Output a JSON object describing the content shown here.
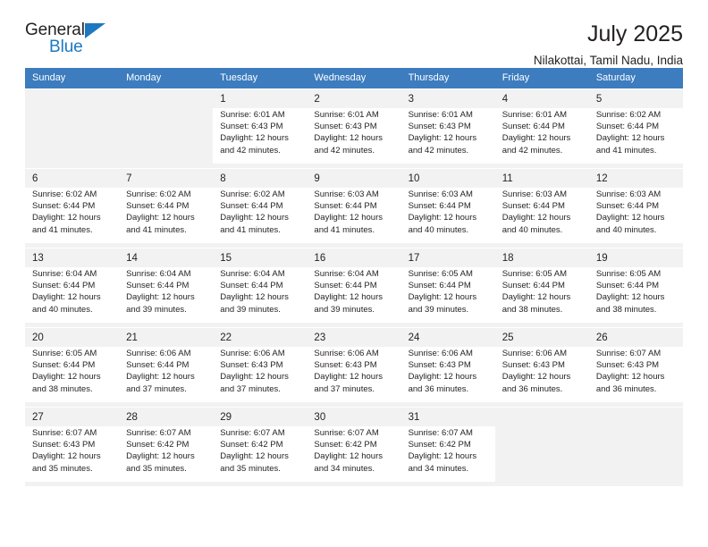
{
  "brand": {
    "word_one": "General",
    "word_two": "Blue",
    "triangle_icon": "brand-triangle-icon"
  },
  "header": {
    "title": "July 2025",
    "location": "Nilakottai, Tamil Nadu, India"
  },
  "colors": {
    "header_row_bg": "#3c7cbf",
    "brand_blue": "#1c79c0",
    "shaded_row_bg": "#f2f2f2",
    "text": "#231f20"
  },
  "weekday_headers": [
    "Sunday",
    "Monday",
    "Tuesday",
    "Wednesday",
    "Thursday",
    "Friday",
    "Saturday"
  ],
  "labels": {
    "sunrise_prefix": "Sunrise:",
    "sunset_prefix": "Sunset:",
    "daylight_prefix": "Daylight:"
  },
  "weeks": [
    [
      {
        "day": "",
        "sunrise": "",
        "sunset": "",
        "daylight_line1": "",
        "daylight_line2": ""
      },
      {
        "day": "",
        "sunrise": "",
        "sunset": "",
        "daylight_line1": "",
        "daylight_line2": ""
      },
      {
        "day": "1",
        "sunrise": "Sunrise: 6:01 AM",
        "sunset": "Sunset: 6:43 PM",
        "daylight_line1": "Daylight: 12 hours",
        "daylight_line2": "and 42 minutes."
      },
      {
        "day": "2",
        "sunrise": "Sunrise: 6:01 AM",
        "sunset": "Sunset: 6:43 PM",
        "daylight_line1": "Daylight: 12 hours",
        "daylight_line2": "and 42 minutes."
      },
      {
        "day": "3",
        "sunrise": "Sunrise: 6:01 AM",
        "sunset": "Sunset: 6:43 PM",
        "daylight_line1": "Daylight: 12 hours",
        "daylight_line2": "and 42 minutes."
      },
      {
        "day": "4",
        "sunrise": "Sunrise: 6:01 AM",
        "sunset": "Sunset: 6:44 PM",
        "daylight_line1": "Daylight: 12 hours",
        "daylight_line2": "and 42 minutes."
      },
      {
        "day": "5",
        "sunrise": "Sunrise: 6:02 AM",
        "sunset": "Sunset: 6:44 PM",
        "daylight_line1": "Daylight: 12 hours",
        "daylight_line2": "and 41 minutes."
      }
    ],
    [
      {
        "day": "6",
        "sunrise": "Sunrise: 6:02 AM",
        "sunset": "Sunset: 6:44 PM",
        "daylight_line1": "Daylight: 12 hours",
        "daylight_line2": "and 41 minutes."
      },
      {
        "day": "7",
        "sunrise": "Sunrise: 6:02 AM",
        "sunset": "Sunset: 6:44 PM",
        "daylight_line1": "Daylight: 12 hours",
        "daylight_line2": "and 41 minutes."
      },
      {
        "day": "8",
        "sunrise": "Sunrise: 6:02 AM",
        "sunset": "Sunset: 6:44 PM",
        "daylight_line1": "Daylight: 12 hours",
        "daylight_line2": "and 41 minutes."
      },
      {
        "day": "9",
        "sunrise": "Sunrise: 6:03 AM",
        "sunset": "Sunset: 6:44 PM",
        "daylight_line1": "Daylight: 12 hours",
        "daylight_line2": "and 41 minutes."
      },
      {
        "day": "10",
        "sunrise": "Sunrise: 6:03 AM",
        "sunset": "Sunset: 6:44 PM",
        "daylight_line1": "Daylight: 12 hours",
        "daylight_line2": "and 40 minutes."
      },
      {
        "day": "11",
        "sunrise": "Sunrise: 6:03 AM",
        "sunset": "Sunset: 6:44 PM",
        "daylight_line1": "Daylight: 12 hours",
        "daylight_line2": "and 40 minutes."
      },
      {
        "day": "12",
        "sunrise": "Sunrise: 6:03 AM",
        "sunset": "Sunset: 6:44 PM",
        "daylight_line1": "Daylight: 12 hours",
        "daylight_line2": "and 40 minutes."
      }
    ],
    [
      {
        "day": "13",
        "sunrise": "Sunrise: 6:04 AM",
        "sunset": "Sunset: 6:44 PM",
        "daylight_line1": "Daylight: 12 hours",
        "daylight_line2": "and 40 minutes."
      },
      {
        "day": "14",
        "sunrise": "Sunrise: 6:04 AM",
        "sunset": "Sunset: 6:44 PM",
        "daylight_line1": "Daylight: 12 hours",
        "daylight_line2": "and 39 minutes."
      },
      {
        "day": "15",
        "sunrise": "Sunrise: 6:04 AM",
        "sunset": "Sunset: 6:44 PM",
        "daylight_line1": "Daylight: 12 hours",
        "daylight_line2": "and 39 minutes."
      },
      {
        "day": "16",
        "sunrise": "Sunrise: 6:04 AM",
        "sunset": "Sunset: 6:44 PM",
        "daylight_line1": "Daylight: 12 hours",
        "daylight_line2": "and 39 minutes."
      },
      {
        "day": "17",
        "sunrise": "Sunrise: 6:05 AM",
        "sunset": "Sunset: 6:44 PM",
        "daylight_line1": "Daylight: 12 hours",
        "daylight_line2": "and 39 minutes."
      },
      {
        "day": "18",
        "sunrise": "Sunrise: 6:05 AM",
        "sunset": "Sunset: 6:44 PM",
        "daylight_line1": "Daylight: 12 hours",
        "daylight_line2": "and 38 minutes."
      },
      {
        "day": "19",
        "sunrise": "Sunrise: 6:05 AM",
        "sunset": "Sunset: 6:44 PM",
        "daylight_line1": "Daylight: 12 hours",
        "daylight_line2": "and 38 minutes."
      }
    ],
    [
      {
        "day": "20",
        "sunrise": "Sunrise: 6:05 AM",
        "sunset": "Sunset: 6:44 PM",
        "daylight_line1": "Daylight: 12 hours",
        "daylight_line2": "and 38 minutes."
      },
      {
        "day": "21",
        "sunrise": "Sunrise: 6:06 AM",
        "sunset": "Sunset: 6:44 PM",
        "daylight_line1": "Daylight: 12 hours",
        "daylight_line2": "and 37 minutes."
      },
      {
        "day": "22",
        "sunrise": "Sunrise: 6:06 AM",
        "sunset": "Sunset: 6:43 PM",
        "daylight_line1": "Daylight: 12 hours",
        "daylight_line2": "and 37 minutes."
      },
      {
        "day": "23",
        "sunrise": "Sunrise: 6:06 AM",
        "sunset": "Sunset: 6:43 PM",
        "daylight_line1": "Daylight: 12 hours",
        "daylight_line2": "and 37 minutes."
      },
      {
        "day": "24",
        "sunrise": "Sunrise: 6:06 AM",
        "sunset": "Sunset: 6:43 PM",
        "daylight_line1": "Daylight: 12 hours",
        "daylight_line2": "and 36 minutes."
      },
      {
        "day": "25",
        "sunrise": "Sunrise: 6:06 AM",
        "sunset": "Sunset: 6:43 PM",
        "daylight_line1": "Daylight: 12 hours",
        "daylight_line2": "and 36 minutes."
      },
      {
        "day": "26",
        "sunrise": "Sunrise: 6:07 AM",
        "sunset": "Sunset: 6:43 PM",
        "daylight_line1": "Daylight: 12 hours",
        "daylight_line2": "and 36 minutes."
      }
    ],
    [
      {
        "day": "27",
        "sunrise": "Sunrise: 6:07 AM",
        "sunset": "Sunset: 6:43 PM",
        "daylight_line1": "Daylight: 12 hours",
        "daylight_line2": "and 35 minutes."
      },
      {
        "day": "28",
        "sunrise": "Sunrise: 6:07 AM",
        "sunset": "Sunset: 6:42 PM",
        "daylight_line1": "Daylight: 12 hours",
        "daylight_line2": "and 35 minutes."
      },
      {
        "day": "29",
        "sunrise": "Sunrise: 6:07 AM",
        "sunset": "Sunset: 6:42 PM",
        "daylight_line1": "Daylight: 12 hours",
        "daylight_line2": "and 35 minutes."
      },
      {
        "day": "30",
        "sunrise": "Sunrise: 6:07 AM",
        "sunset": "Sunset: 6:42 PM",
        "daylight_line1": "Daylight: 12 hours",
        "daylight_line2": "and 34 minutes."
      },
      {
        "day": "31",
        "sunrise": "Sunrise: 6:07 AM",
        "sunset": "Sunset: 6:42 PM",
        "daylight_line1": "Daylight: 12 hours",
        "daylight_line2": "and 34 minutes."
      },
      {
        "day": "",
        "sunrise": "",
        "sunset": "",
        "daylight_line1": "",
        "daylight_line2": ""
      },
      {
        "day": "",
        "sunrise": "",
        "sunset": "",
        "daylight_line1": "",
        "daylight_line2": ""
      }
    ]
  ]
}
